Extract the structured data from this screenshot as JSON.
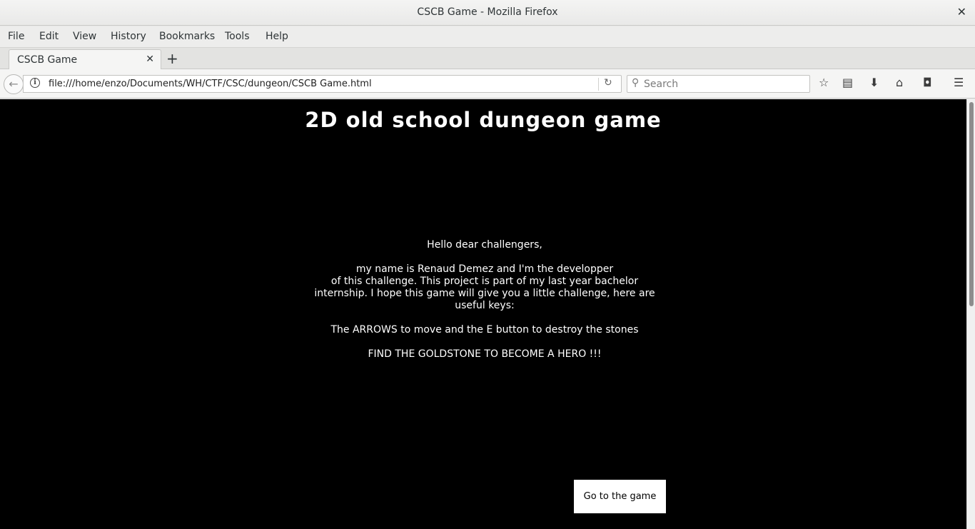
{
  "window": {
    "title": "CSCB Game - Mozilla Firefox"
  },
  "menu": [
    "File",
    "Edit",
    "View",
    "History",
    "Bookmarks",
    "Tools",
    "Help"
  ],
  "tab": {
    "title": "CSCB Game"
  },
  "navbar": {
    "url": "file:///home/enzo/Documents/WH/CTF/CSC/dungeon/CSCB Game.html",
    "search_placeholder": "Search"
  },
  "page": {
    "title": "2D old school dungeon game",
    "greeting": "Hello dear challengers,",
    "line1": "my name is Renaud Demez and I'm the developper",
    "line2": "of this challenge. This project is part of my last year bachelor",
    "line3": "internship. I hope this game will give you a little challenge, here are",
    "line4": "useful keys:",
    "keys": "The ARROWS to move and the E button to destroy the stones",
    "goal": "FIND THE GOLDSTONE TO BECOME A HERO !!!",
    "button": "Go to the game"
  },
  "colors": {
    "page_bg": "#000000",
    "page_text": "#ffffff",
    "button_bg": "#ffffff"
  }
}
